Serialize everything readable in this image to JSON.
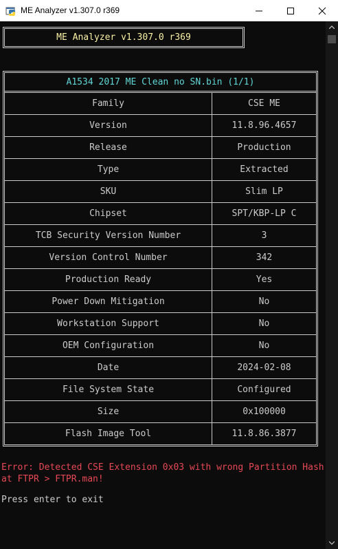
{
  "window": {
    "title": "ME Analyzer v1.307.0 r369",
    "icon": "python-icon",
    "controls": [
      "minimize-icon",
      "maximize-icon",
      "close-icon"
    ]
  },
  "console": {
    "header": "ME Analyzer v1.307.0 r369",
    "table_title": "A1534 2017 ME Clean no SN.bin (1/1)",
    "rows": [
      {
        "key": "Family",
        "value": "CSE ME"
      },
      {
        "key": "Version",
        "value": "11.8.96.4657"
      },
      {
        "key": "Release",
        "value": "Production"
      },
      {
        "key": "Type",
        "value": "Extracted"
      },
      {
        "key": "SKU",
        "value": "Slim LP"
      },
      {
        "key": "Chipset",
        "value": "SPT/KBP-LP C"
      },
      {
        "key": "TCB Security Version Number",
        "value": "3"
      },
      {
        "key": "Version Control Number",
        "value": "342"
      },
      {
        "key": "Production Ready",
        "value": "Yes"
      },
      {
        "key": "Power Down Mitigation",
        "value": "No"
      },
      {
        "key": "Workstation Support",
        "value": "No"
      },
      {
        "key": "OEM Configuration",
        "value": "No"
      },
      {
        "key": "Date",
        "value": "2024-02-08"
      },
      {
        "key": "File System State",
        "value": "Configured"
      },
      {
        "key": "Size",
        "value": "0x100000"
      },
      {
        "key": "Flash Image Tool",
        "value": "11.8.86.3877"
      }
    ],
    "error": "Error: Detected CSE Extension 0x03 with wrong Partition Hash at FTPR > FTPR.man!",
    "prompt": "Press enter to exit"
  },
  "colors": {
    "background": "#0c0c0c",
    "text": "#cccccc",
    "header_text": "#f9f1a5",
    "title_text": "#61d6d6",
    "error_text": "#e74856"
  }
}
